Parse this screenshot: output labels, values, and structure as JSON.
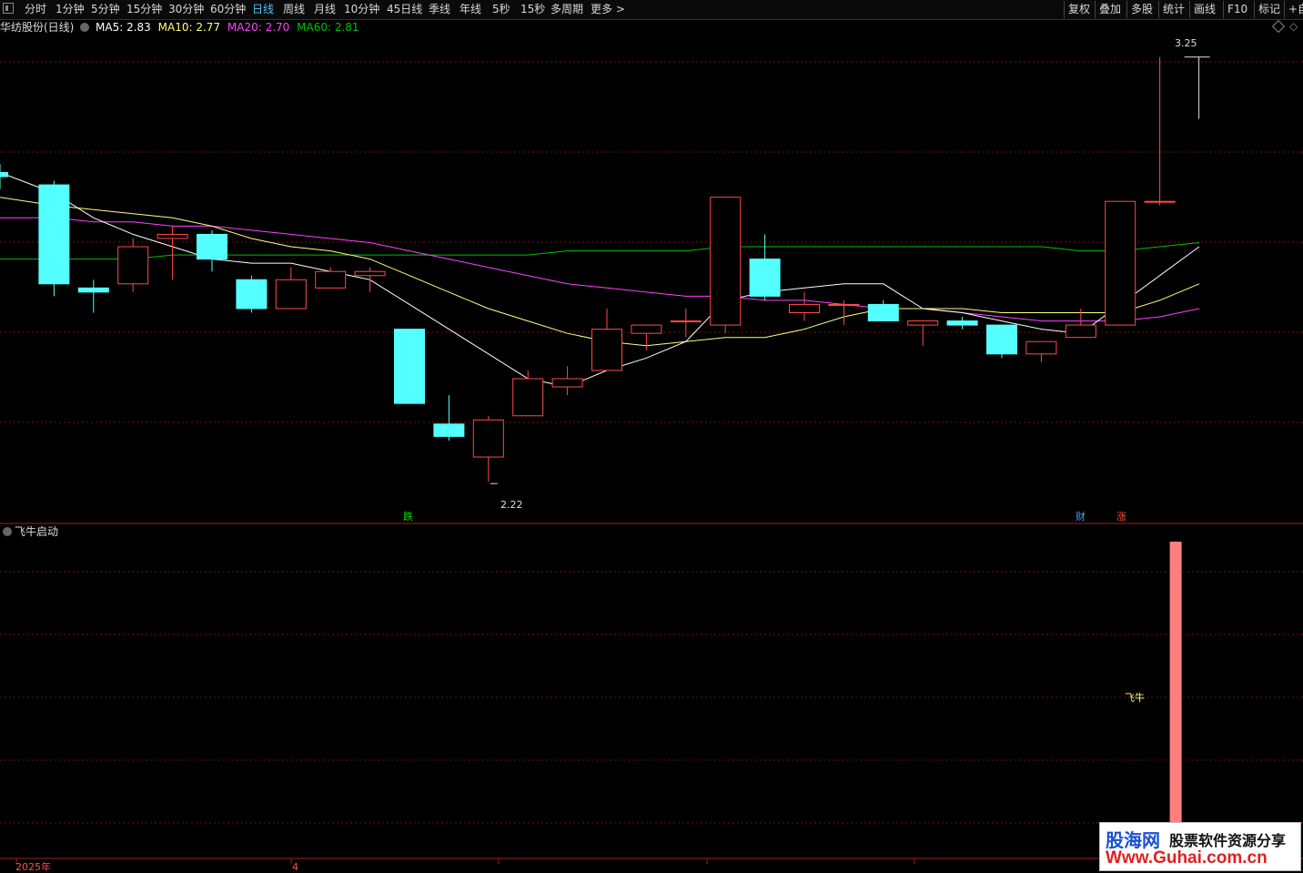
{
  "toolbar": {
    "periods": [
      "分时",
      "1分钟",
      "5分钟",
      "15分钟",
      "30分钟",
      "60分钟",
      "日线",
      "周线",
      "月线",
      "10分钟",
      "45日线",
      "季线",
      "年线",
      "5秒",
      "15秒",
      "多周期",
      "更多 >"
    ],
    "active_index": 6,
    "right_buttons": [
      "复权",
      "叠加",
      "多股",
      "统计",
      "画线",
      "F10",
      "标记",
      "+自"
    ]
  },
  "info": {
    "title": "华纺股份(日线)",
    "ma5": "MA5: 2.83",
    "ma10": "MA10: 2.77",
    "ma20": "MA20: 2.70",
    "ma60": "MA60: 2.81"
  },
  "indicator": {
    "name": "飞牛启动",
    "signal_label": "飞牛"
  },
  "markers": {
    "die": "跌",
    "cai": "财",
    "zhang": "涨"
  },
  "annotations": {
    "high": "3.25",
    "low": "2.22"
  },
  "time_axis": {
    "year_label": "2025年",
    "month_label": "4"
  },
  "watermark": {
    "logo": "股海网",
    "slogan": "股票软件资源分享",
    "url": "Www.Guhai.com.cn"
  },
  "colors": {
    "up": "#ff4a4a",
    "down": "#54ffff",
    "ma5": "#ffffff",
    "ma10": "#ffff7f",
    "ma20": "#ff40ff",
    "ma60": "#00c000",
    "grid": "#7a1010",
    "signal_bar": "#ff7f7f"
  },
  "chart_data": {
    "type": "candlestick",
    "ylim": [
      2.13,
      3.3
    ],
    "candles": [
      {
        "o": 2.97,
        "h": 2.99,
        "l": 2.93,
        "c": 2.96
      },
      {
        "o": 2.94,
        "h": 2.95,
        "l": 2.67,
        "c": 2.7
      },
      {
        "o": 2.69,
        "h": 2.71,
        "l": 2.63,
        "c": 2.68
      },
      {
        "o": 2.7,
        "h": 2.81,
        "l": 2.68,
        "c": 2.79
      },
      {
        "o": 2.81,
        "h": 2.84,
        "l": 2.71,
        "c": 2.82
      },
      {
        "o": 2.82,
        "h": 2.83,
        "l": 2.73,
        "c": 2.76
      },
      {
        "o": 2.71,
        "h": 2.72,
        "l": 2.63,
        "c": 2.64
      },
      {
        "o": 2.64,
        "h": 2.74,
        "l": 2.64,
        "c": 2.71
      },
      {
        "o": 2.69,
        "h": 2.74,
        "l": 2.69,
        "c": 2.73
      },
      {
        "o": 2.72,
        "h": 2.74,
        "l": 2.68,
        "c": 2.73
      },
      {
        "o": 2.59,
        "h": 2.59,
        "l": 2.41,
        "c": 2.41
      },
      {
        "o": 2.36,
        "h": 2.43,
        "l": 2.32,
        "c": 2.33
      },
      {
        "o": 2.28,
        "h": 2.38,
        "l": 2.22,
        "c": 2.37
      },
      {
        "o": 2.38,
        "h": 2.49,
        "l": 2.38,
        "c": 2.47
      },
      {
        "o": 2.45,
        "h": 2.5,
        "l": 2.43,
        "c": 2.47
      },
      {
        "o": 2.49,
        "h": 2.64,
        "l": 2.49,
        "c": 2.59
      },
      {
        "o": 2.58,
        "h": 2.6,
        "l": 2.54,
        "c": 2.6
      },
      {
        "o": 2.61,
        "h": 2.64,
        "l": 2.57,
        "c": 2.61
      },
      {
        "o": 2.6,
        "h": 2.91,
        "l": 2.58,
        "c": 2.91
      },
      {
        "o": 2.76,
        "h": 2.82,
        "l": 2.66,
        "c": 2.67
      },
      {
        "o": 2.63,
        "h": 2.68,
        "l": 2.61,
        "c": 2.65
      },
      {
        "o": 2.65,
        "h": 2.66,
        "l": 2.6,
        "c": 2.65
      },
      {
        "o": 2.65,
        "h": 2.66,
        "l": 2.61,
        "c": 2.61
      },
      {
        "o": 2.6,
        "h": 2.61,
        "l": 2.55,
        "c": 2.61
      },
      {
        "o": 2.61,
        "h": 2.62,
        "l": 2.59,
        "c": 2.6
      },
      {
        "o": 2.6,
        "h": 2.6,
        "l": 2.52,
        "c": 2.53
      },
      {
        "o": 2.53,
        "h": 2.56,
        "l": 2.51,
        "c": 2.56
      },
      {
        "o": 2.57,
        "h": 2.64,
        "l": 2.57,
        "c": 2.6
      },
      {
        "o": 2.6,
        "h": 2.9,
        "l": 2.6,
        "c": 2.9
      },
      {
        "o": 2.9,
        "h": 3.25,
        "l": 2.89,
        "c": 2.9
      }
    ],
    "ma5": [
      2.97,
      2.92,
      2.86,
      2.82,
      2.79,
      2.76,
      2.75,
      2.75,
      2.73,
      2.71,
      2.65,
      2.59,
      2.53,
      2.47,
      2.45,
      2.49,
      2.52,
      2.56,
      2.66,
      2.68,
      2.69,
      2.7,
      2.7,
      2.64,
      2.63,
      2.61,
      2.59,
      2.58,
      2.65,
      2.72,
      2.79
    ],
    "ma10": [
      2.91,
      2.89,
      2.88,
      2.87,
      2.86,
      2.84,
      2.81,
      2.79,
      2.78,
      2.76,
      2.72,
      2.68,
      2.64,
      2.61,
      2.58,
      2.56,
      2.55,
      2.56,
      2.57,
      2.57,
      2.59,
      2.62,
      2.64,
      2.64,
      2.64,
      2.63,
      2.63,
      2.63,
      2.63,
      2.66,
      2.7
    ],
    "ma20": [
      2.86,
      2.86,
      2.85,
      2.85,
      2.84,
      2.84,
      2.83,
      2.82,
      2.81,
      2.8,
      2.78,
      2.76,
      2.74,
      2.72,
      2.7,
      2.69,
      2.68,
      2.67,
      2.67,
      2.66,
      2.66,
      2.65,
      2.64,
      2.64,
      2.63,
      2.62,
      2.61,
      2.61,
      2.61,
      2.62,
      2.64
    ],
    "ma60": [
      2.76,
      2.76,
      2.76,
      2.76,
      2.77,
      2.77,
      2.77,
      2.77,
      2.77,
      2.77,
      2.77,
      2.77,
      2.77,
      2.77,
      2.78,
      2.78,
      2.78,
      2.78,
      2.79,
      2.79,
      2.79,
      2.79,
      2.79,
      2.79,
      2.79,
      2.79,
      2.79,
      2.78,
      2.78,
      2.79,
      2.8
    ],
    "signal_index": 29,
    "signal_value": 1
  }
}
